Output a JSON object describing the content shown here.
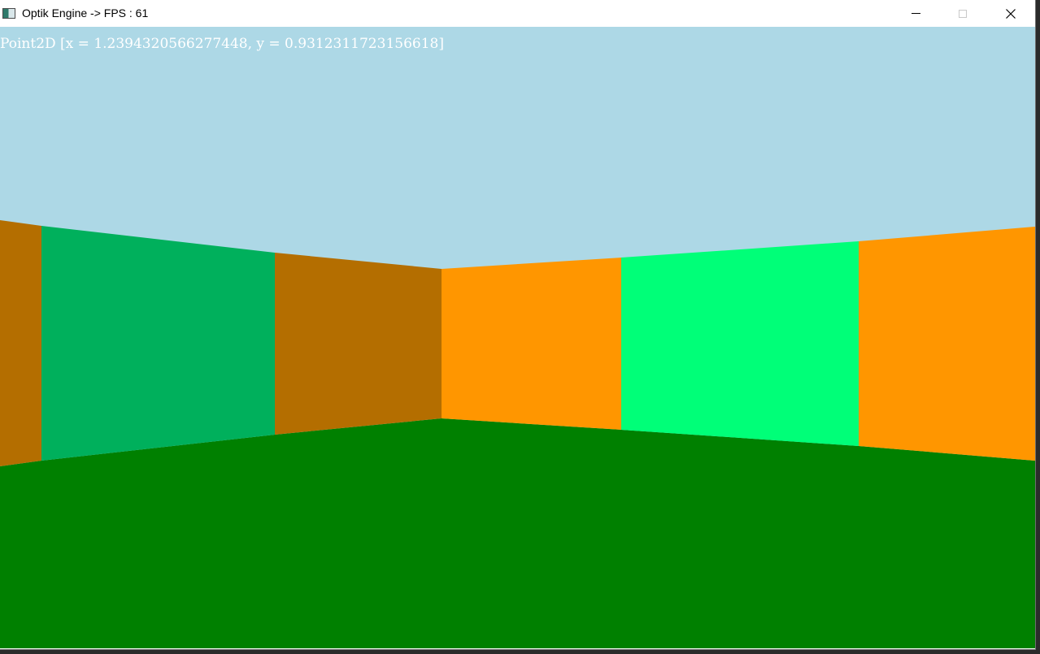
{
  "window": {
    "title": "Optik Engine -> FPS : 61",
    "app_icon": "app-window-icon",
    "controls": {
      "minimize_icon": "minimize-icon",
      "maximize_icon": "maximize-icon",
      "close_icon": "close-icon"
    }
  },
  "scene": {
    "overlay_text": "Point2D [x = 1.2394320566277448, y = 0.9312311723156618]",
    "colors": {
      "sky": "#add8e6",
      "floor": "#008000",
      "wall_dark_orange": "#b46e00",
      "wall_teal_green": "#00b05c",
      "wall_orange": "#ff9600",
      "wall_bright_green": "#00ff78",
      "overlay_text": "#ffffff"
    }
  }
}
